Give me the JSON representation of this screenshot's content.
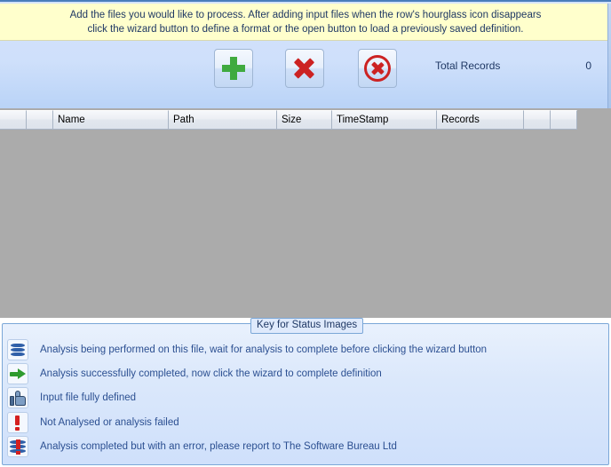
{
  "banner": {
    "text": "Add the files you would like to process.  After adding input files when the row's hourglass icon disappears\nclick the wizard button to define a format or the open button to load a previously saved definition."
  },
  "toolbar": {
    "add_button_icon": "plus-icon",
    "remove_button_icon": "cross-icon",
    "clear_button_icon": "circle-cross-icon",
    "total_records_label": "Total Records",
    "total_records_value": "0"
  },
  "grid": {
    "columns": [
      {
        "label": "",
        "width": 30
      },
      {
        "label": "",
        "width": 30
      },
      {
        "label": "Name",
        "width": 130
      },
      {
        "label": "Path",
        "width": 122
      },
      {
        "label": "Size",
        "width": 62
      },
      {
        "label": "TimeStamp",
        "width": 118
      },
      {
        "label": "Records",
        "width": 98
      },
      {
        "label": "",
        "width": 30
      },
      {
        "label": "",
        "width": 30
      }
    ],
    "rows": []
  },
  "key_group": {
    "title": "Key for Status Images",
    "items": [
      {
        "icon": "stacked-layers-icon",
        "label": "Analysis being performed on this file, wait for analysis to complete before clicking the wizard button"
      },
      {
        "icon": "green-arrow-icon",
        "label": "Analysis successfully completed, now click the wizard to complete definition"
      },
      {
        "icon": "thumbs-up-icon",
        "label": "Input file fully defined"
      },
      {
        "icon": "exclamation-icon",
        "label": "Not Analysed or analysis failed"
      },
      {
        "icon": "stacked-layers-error-icon",
        "label": "Analysis completed but with an error, please report to The Software Bureau Ltd"
      }
    ]
  },
  "colors": {
    "banner_background": "#ffffcc",
    "panel_background": "#cfe0fb",
    "grid_background": "#ababab",
    "accent_border": "#4a7ebb",
    "text": "#1f3864",
    "add_icon": "#3faa3f",
    "remove_icon": "#cc2222",
    "error_icon": "#d42020"
  }
}
